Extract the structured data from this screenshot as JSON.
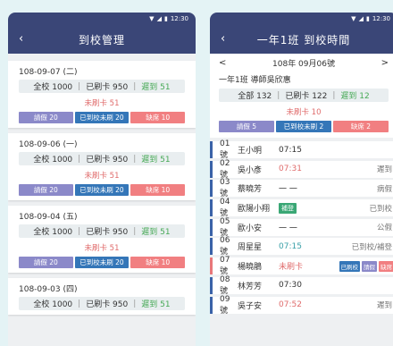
{
  "status_bar": {
    "time": "12:30"
  },
  "left": {
    "title": "到校管理",
    "cards": [
      {
        "date": "108-09-07 (二)",
        "all_label": "全校 1000",
        "card_label": "已刷卡 950",
        "late_label": "遲到 51",
        "unswiped": "未刷卡 51",
        "buttons": [
          "請假 20",
          "已到校未刷 20",
          "缺席 10"
        ]
      },
      {
        "date": "108-09-06 (一)",
        "all_label": "全校 1000",
        "card_label": "已刷卡 950",
        "late_label": "遲到 51",
        "unswiped": "未刷卡 51",
        "buttons": [
          "請假 20",
          "已到校未刷 20",
          "缺席 10"
        ]
      },
      {
        "date": "108-09-04 (五)",
        "all_label": "全校 1000",
        "card_label": "已刷卡 950",
        "late_label": "遲到 51",
        "unswiped": "未刷卡 51",
        "buttons": [
          "請假 20",
          "已到校未刷 20",
          "缺席 10"
        ]
      },
      {
        "date": "108-09-03 (四)",
        "all_label": "全校 1000",
        "card_label": "已刷卡 950",
        "late_label": "遲到 51",
        "unswiped": "",
        "buttons": []
      }
    ]
  },
  "right": {
    "title": "一年1班 到校時間",
    "date_nav": {
      "prev": "<",
      "date": "108年 09月06號",
      "next": ">"
    },
    "teacher": "一年1班 導師吳欣惠",
    "summary": {
      "all": "全部 132",
      "card": "已刷卡 122",
      "late": "遲到 12"
    },
    "unswiped": "未刷卡 10",
    "buttons": [
      "請假 5",
      "已到校未刷 2",
      "缺席 2"
    ],
    "students": [
      {
        "num": "01號",
        "name": "王小明",
        "time": "07:15",
        "time_class": "",
        "status": "",
        "tag": "",
        "mini": []
      },
      {
        "num": "02號",
        "name": "吳小彥",
        "time": "07:31",
        "time_class": "late",
        "status": "遲到",
        "tag": "",
        "mini": []
      },
      {
        "num": "03號",
        "name": "蔡曉芳",
        "time": "一 一",
        "time_class": "",
        "status": "病假",
        "tag": "",
        "mini": []
      },
      {
        "num": "04號",
        "name": "歐陽小翔",
        "time": "",
        "time_class": "",
        "status": "已到校",
        "tag": "補登",
        "mini": []
      },
      {
        "num": "05號",
        "name": "歐小安",
        "time": "一 一",
        "time_class": "",
        "status": "公假",
        "tag": "",
        "mini": []
      },
      {
        "num": "06號",
        "name": "周星星",
        "time": "07:15",
        "time_class": "ok",
        "status": "已到校/補登",
        "tag": "",
        "mini": []
      },
      {
        "num": "07號",
        "name": "楊曉鵑",
        "time": "未刷卡",
        "time_class": "miss",
        "status": "",
        "tag": "",
        "mini": [
          "已刷校",
          "請假",
          "缺席"
        ]
      },
      {
        "num": "08號",
        "name": "林芳芳",
        "time": "07:30",
        "time_class": "",
        "status": "",
        "tag": "",
        "mini": []
      },
      {
        "num": "09號",
        "name": "吳子安",
        "time": "07:52",
        "time_class": "late",
        "status": "遲到",
        "tag": "",
        "mini": []
      }
    ]
  },
  "colors": {
    "header": "#3a4677",
    "leave": "#8b89c9",
    "noswipe": "#3476b8",
    "absent": "#f17f81",
    "late_text": "#47a956",
    "alert_text": "#e06c6c"
  }
}
